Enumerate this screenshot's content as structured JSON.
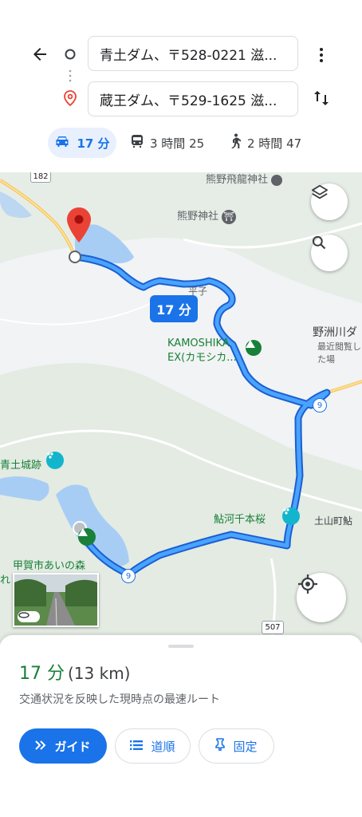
{
  "directions": {
    "origin_value": "青土ダム、〒528-0221 滋...",
    "destination_value": "蔵王ダム、〒529-1625 滋...",
    "modes": [
      {
        "name": "car",
        "label": "17 分",
        "selected": true
      },
      {
        "name": "transit",
        "label": "3 時間 25",
        "selected": false
      },
      {
        "name": "walk",
        "label": "2 時間 47",
        "selected": false
      }
    ]
  },
  "map": {
    "route_badge": "17 分",
    "road_182": "182",
    "road_9a": "9",
    "road_9b": "9",
    "road_507": "507",
    "labels": {
      "kumano_hiryu": "熊野飛龍神社",
      "kumano": "熊野神社",
      "heijo": "平子",
      "nosu_top": "野洲川ダ",
      "nosu_sub": "最近閲覧した場",
      "kamoshika_1": "KAMOSHIKA",
      "kamoshika_2": "EX(カモシカ...",
      "ozuchi_castle": "青土城跡",
      "ayukawa": "鮎河千本桜",
      "tsuchiyama": "土山町鮎",
      "koka_ai": "甲賀市あいの森",
      "koka_sub": "れ"
    }
  },
  "sheet": {
    "duration": "17 分",
    "distance": "(13 km)",
    "note": "交通状況を反映した現時点の最速ルート",
    "guide_label": "ガイド",
    "steps_label": "道順",
    "pin_label": "固定"
  },
  "colors": {
    "route": "#4285f4",
    "route_border": "#1a5fd0",
    "accent": "#1a73e8",
    "duration_green": "#188038",
    "pin_red": "#ea4335",
    "water": "#a8cdf5",
    "poi_green": "#188038",
    "poi_teal": "#12b5cb"
  }
}
